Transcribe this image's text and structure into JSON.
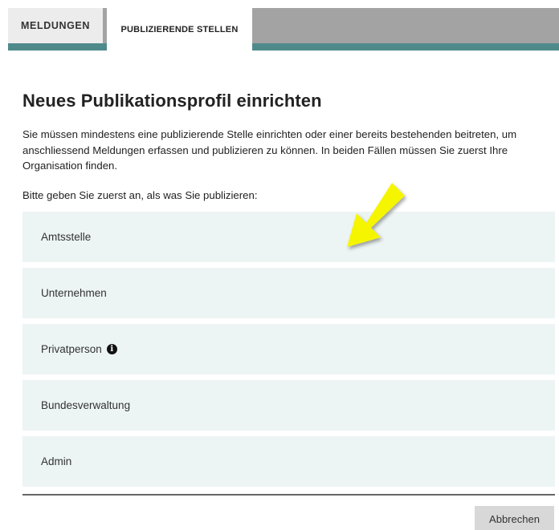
{
  "tabs": [
    {
      "label": "Meldungen"
    },
    {
      "label": "Publizierende Stellen"
    }
  ],
  "colors": {
    "accent_teal": "#4f8a8b",
    "option_bg": "#edf4f4",
    "annotation_arrow": "#f5f500"
  },
  "page": {
    "title": "Neues Publikationsprofil einrichten",
    "intro": "Sie müssen mindestens eine publizierende Stelle einrichten oder einer bereits bestehenden beitreten, um anschliessend Meldungen erfassen und publizieren zu können. In beiden Fällen müssen Sie zuerst Ihre Organisation finden.",
    "prompt": "Bitte geben Sie zuerst an, als was Sie publizieren:"
  },
  "options": [
    {
      "label": "Amtsstelle"
    },
    {
      "label": "Unternehmen"
    },
    {
      "label": "Privatperson",
      "icon": "info-icon"
    },
    {
      "label": "Bundesverwaltung"
    },
    {
      "label": "Admin"
    }
  ],
  "footer": {
    "cancel_label": "Abbrechen"
  }
}
